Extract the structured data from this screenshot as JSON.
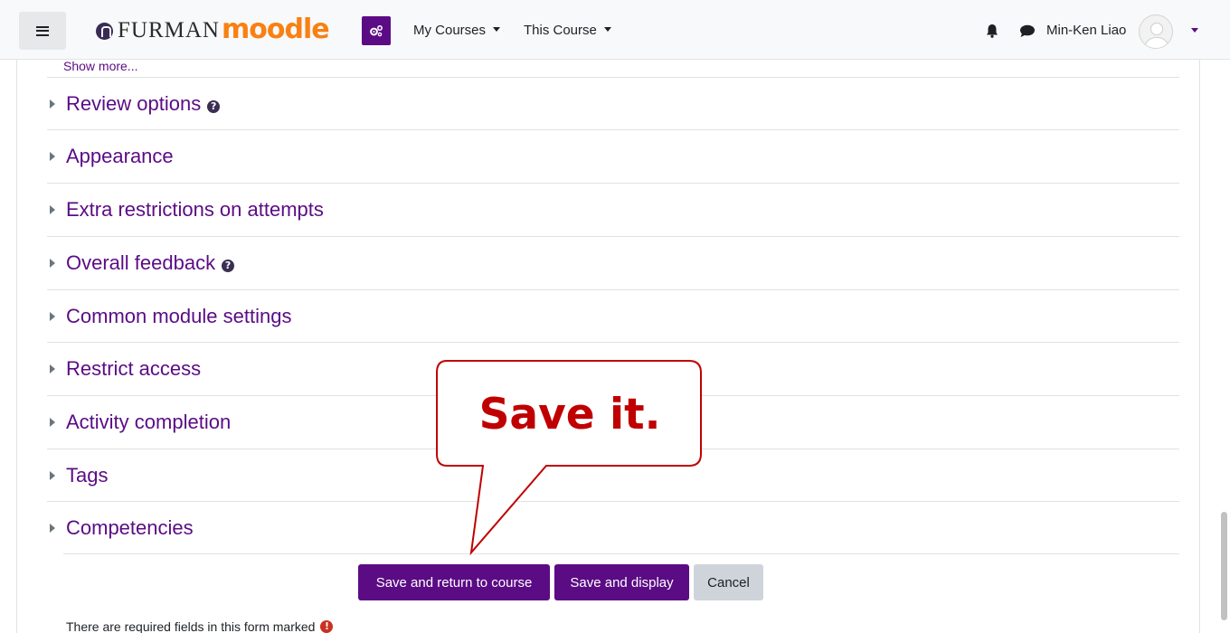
{
  "navbar": {
    "brand_furman": "FURMAN",
    "brand_moodle": "moodle",
    "my_courses": "My Courses",
    "this_course": "This Course",
    "user_name": "Min-Ken Liao"
  },
  "form": {
    "show_more": "Show more...",
    "sections": [
      {
        "label": "Review options",
        "help": true
      },
      {
        "label": "Appearance",
        "help": false
      },
      {
        "label": "Extra restrictions on attempts",
        "help": false
      },
      {
        "label": "Overall feedback",
        "help": true
      },
      {
        "label": "Common module settings",
        "help": false
      },
      {
        "label": "Restrict access",
        "help": false
      },
      {
        "label": "Activity completion",
        "help": false
      },
      {
        "label": "Tags",
        "help": false
      },
      {
        "label": "Competencies",
        "help": false
      }
    ],
    "buttons": {
      "save_return": "Save and return to course",
      "save_display": "Save and display",
      "cancel": "Cancel"
    },
    "required_note": "There are required fields in this form marked"
  },
  "callout": {
    "text": "Save it."
  },
  "colors": {
    "brand_purple": "#5b0c85",
    "moodle_orange": "#f98012",
    "callout_red": "#c00000"
  },
  "icons": {
    "menu": "hamburger-icon",
    "admin": "cogs-icon",
    "notifications": "bell-icon",
    "messages": "chat-icon",
    "help": "question-circle-icon",
    "required": "exclamation-circle-icon"
  }
}
